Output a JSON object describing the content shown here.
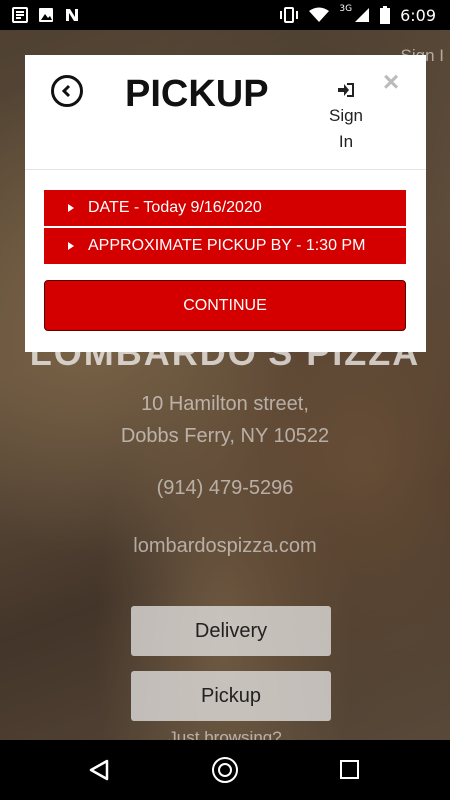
{
  "status_bar": {
    "time": "6:09",
    "network": "3G",
    "left_icons": [
      "notification-list-icon",
      "image-icon",
      "n-app-icon"
    ],
    "right_icons": [
      "vibrate-icon",
      "wifi-icon",
      "signal-icon",
      "battery-icon"
    ]
  },
  "background": {
    "sign_in": "Sign I",
    "restaurant_name": "LOMBARDO'S PIZZA",
    "address_line1": "10 Hamilton street,",
    "address_line2": "Dobbs Ferry, NY 10522",
    "phone": "(914) 479-5296",
    "website": "lombardospizza.com",
    "delivery_button": "Delivery",
    "pickup_button": "Pickup",
    "browsing_link": "Just browsing?"
  },
  "modal": {
    "title": "PICKUP",
    "sign_in_line1": "Sign",
    "sign_in_line2": "In",
    "close_symbol": "×",
    "date_option": "DATE - Today 9/16/2020",
    "time_option": "APPROXIMATE PICKUP BY - 1:30 PM",
    "continue_label": "CONTINUE",
    "accent_color": "#d40000"
  },
  "nav_bar": {
    "icons": [
      "back-triangle-icon",
      "home-circle-icon",
      "recents-square-icon"
    ]
  }
}
